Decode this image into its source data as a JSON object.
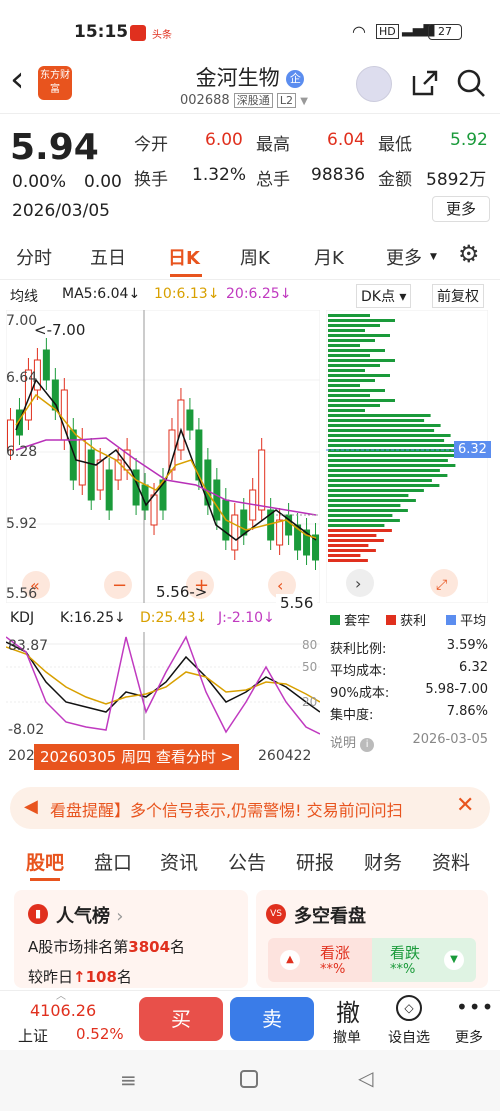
{
  "status": {
    "time": "15:15",
    "app_badge": "头条",
    "battery": "27"
  },
  "header": {
    "back": "‹",
    "logo": "东方财富",
    "name": "金河生物",
    "badge": "企",
    "code": "002688",
    "market": "深股通",
    "level": "L2"
  },
  "quote": {
    "price": "5.94",
    "change_pct": "0.00%",
    "change": "0.00",
    "date": "2026/03/05",
    "open_label": "今开",
    "open": "6.00",
    "high_label": "最高",
    "high": "6.04",
    "low_label": "最低",
    "low": "5.92",
    "turnover_label": "换手",
    "turnover": "1.32%",
    "vol_label": "总手",
    "vol": "98836",
    "amount_label": "金额",
    "amount": "5892万",
    "more": "更多"
  },
  "tabs": [
    "分时",
    "五日",
    "日K",
    "周K",
    "月K",
    "更多",
    "⚙"
  ],
  "chart": {
    "indicator": "均线",
    "ma5": "MA5:6.04",
    "ma10": "10:6.13",
    "ma20": "20:6.25",
    "dk": "DK点",
    "fq": "前复权",
    "y_top": "7.00",
    "y_mid1": "6.64",
    "y_mid2": "6.28",
    "y_mid3": "5.92",
    "y_bot": "5.56",
    "high_mark": "<-7.00",
    "low_mark": "5.56->",
    "cur_low": "5.56",
    "profile_price": "6.32",
    "kdj_label": "KDJ",
    "k": "K:16.25",
    "d": "D:25.43",
    "j": "J:-2.10",
    "kdj_top": "83.87",
    "kdj_bot": "-8.02",
    "kdj_80": "80",
    "kdj_50": "50",
    "kdj_20": "20",
    "date_left": "202",
    "date_right": "260422",
    "date_tooltip": "20260305 周四 查看分时 >"
  },
  "profile": {
    "legend_trapped": "套牢",
    "legend_profit": "获利",
    "legend_avg": "平均",
    "rows": [
      {
        "label": "获利比例:",
        "value": "3.59%"
      },
      {
        "label": "平均成本:",
        "value": "6.32"
      },
      {
        "label": "90%成本:",
        "value": "5.98-7.00"
      },
      {
        "label": "集中度:",
        "value": "7.86%"
      }
    ],
    "note": "说明",
    "note_date": "2026-03-05"
  },
  "banner": {
    "text": "看盘提醒】多个信号表示,仍需警惕! 交易前问问扫"
  },
  "subtabs": [
    "股吧",
    "盘口",
    "资讯",
    "公告",
    "研报",
    "财务",
    "资料"
  ],
  "cards": {
    "pop_title": "人气榜",
    "pop_line1_pre": "A股市场排名第",
    "pop_rank": "3804",
    "pop_line1_post": "名",
    "pop_line2_pre": "较昨日",
    "pop_change": "108",
    "pop_line2_post": "名",
    "vs_title": "多空看盘",
    "bull": "看涨",
    "bull_val": "**%",
    "bear": "看跌",
    "bear_val": "**%"
  },
  "bottom": {
    "index": "4106.26",
    "index_name": "上证",
    "index_pct": "0.52%",
    "buy": "买",
    "sell": "卖",
    "cancel": "撤单",
    "cancel_icon": "撤",
    "watch": "设自选",
    "more": "更多"
  },
  "colors": {
    "red": "#e0301e",
    "green": "#1a9a3a",
    "accent": "#e8541e"
  }
}
